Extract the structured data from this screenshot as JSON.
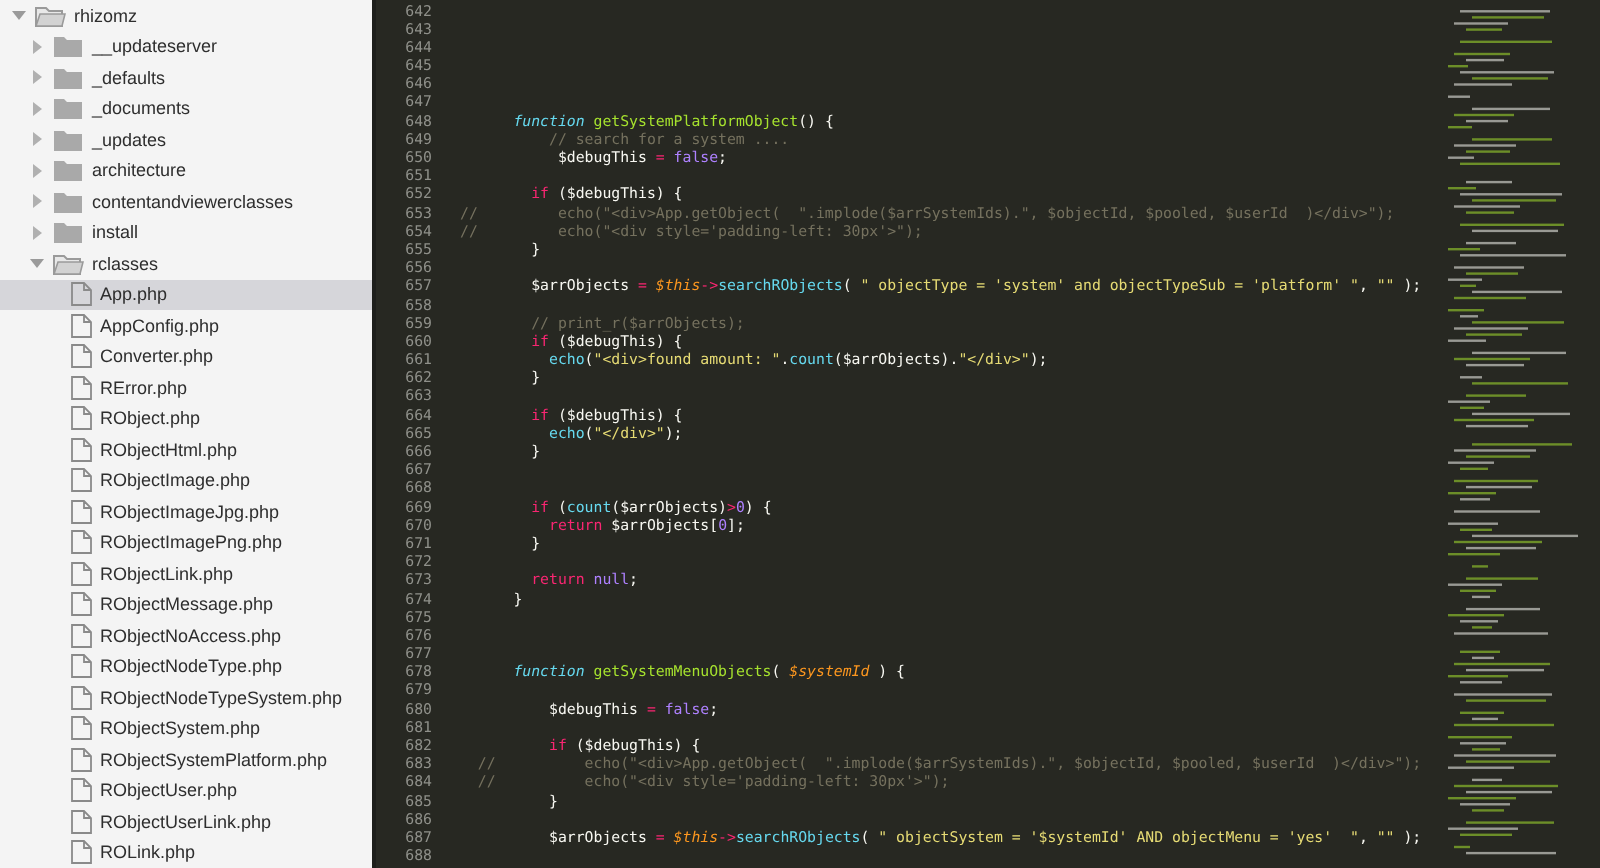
{
  "sidebar": {
    "items": [
      {
        "kind": "folder",
        "label": "rhizomz",
        "expanded": true,
        "selected": false,
        "children": [
          {
            "kind": "folder",
            "label": "__updateserver",
            "expanded": false,
            "selected": false
          },
          {
            "kind": "folder",
            "label": "_defaults",
            "expanded": false,
            "selected": false
          },
          {
            "kind": "folder",
            "label": "_documents",
            "expanded": false,
            "selected": false
          },
          {
            "kind": "folder",
            "label": "_updates",
            "expanded": false,
            "selected": false
          },
          {
            "kind": "folder",
            "label": "architecture",
            "expanded": false,
            "selected": false
          },
          {
            "kind": "folder",
            "label": "contentandviewerclasses",
            "expanded": false,
            "selected": false
          },
          {
            "kind": "folder",
            "label": "install",
            "expanded": false,
            "selected": false
          },
          {
            "kind": "folder",
            "label": "rclasses",
            "expanded": true,
            "selected": false,
            "children": [
              {
                "kind": "file",
                "label": "App.php",
                "selected": true
              },
              {
                "kind": "file",
                "label": "AppConfig.php",
                "selected": false
              },
              {
                "kind": "file",
                "label": "Converter.php",
                "selected": false
              },
              {
                "kind": "file",
                "label": "RError.php",
                "selected": false
              },
              {
                "kind": "file",
                "label": "RObject.php",
                "selected": false
              },
              {
                "kind": "file",
                "label": "RObjectHtml.php",
                "selected": false
              },
              {
                "kind": "file",
                "label": "RObjectImage.php",
                "selected": false
              },
              {
                "kind": "file",
                "label": "RObjectImageJpg.php",
                "selected": false
              },
              {
                "kind": "file",
                "label": "RObjectImagePng.php",
                "selected": false
              },
              {
                "kind": "file",
                "label": "RObjectLink.php",
                "selected": false
              },
              {
                "kind": "file",
                "label": "RObjectMessage.php",
                "selected": false
              },
              {
                "kind": "file",
                "label": "RObjectNoAccess.php",
                "selected": false
              },
              {
                "kind": "file",
                "label": "RObjectNodeType.php",
                "selected": false
              },
              {
                "kind": "file",
                "label": "RObjectNodeTypeSystem.php",
                "selected": false
              },
              {
                "kind": "file",
                "label": "RObjectSystem.php",
                "selected": false
              },
              {
                "kind": "file",
                "label": "RObjectSystemPlatform.php",
                "selected": false
              },
              {
                "kind": "file",
                "label": "RObjectUser.php",
                "selected": false
              },
              {
                "kind": "file",
                "label": "RObjectUserLink.php",
                "selected": false
              },
              {
                "kind": "file",
                "label": "ROLink.php",
                "selected": false
              }
            ]
          }
        ]
      }
    ]
  },
  "editor": {
    "lines": [
      {
        "number": "642"
      },
      {
        "number": "643"
      },
      {
        "number": "644"
      },
      {
        "number": "645"
      },
      {
        "number": "646"
      },
      {
        "number": "647"
      },
      {
        "number": "648",
        "tokens": [
          {
            "kind": "keyword",
            "text": "      function"
          },
          {
            "kind": "fn",
            "text": " getSystemPlatformObject"
          },
          {
            "kind": "plain",
            "text": "() {"
          }
        ]
      },
      {
        "number": "649",
        "tokens": [
          {
            "kind": "comment",
            "text": "          // search for a system ...."
          }
        ]
      },
      {
        "number": "650",
        "tokens": [
          {
            "kind": "plain",
            "text": "           $debugThis "
          },
          {
            "kind": "op",
            "text": "="
          },
          {
            "kind": "const",
            "text": " false"
          },
          {
            "kind": "plain",
            "text": ";"
          }
        ]
      },
      {
        "number": "651"
      },
      {
        "number": "652",
        "tokens": [
          {
            "kind": "ctrl",
            "text": "        if"
          },
          {
            "kind": "plain",
            "text": " ($debugThis) {"
          }
        ]
      },
      {
        "number": "653",
        "tokens": [
          {
            "kind": "comment",
            "text": "//         echo(\"<div>App.getObject(  \".implode($arrSystemIds).\", $objectId, $pooled, $userId  )</div>\");"
          }
        ]
      },
      {
        "number": "654",
        "tokens": [
          {
            "kind": "comment",
            "text": "//         echo(\"<div style='padding-left: 30px'>\");"
          }
        ]
      },
      {
        "number": "655",
        "tokens": [
          {
            "kind": "plain",
            "text": "        }"
          }
        ]
      },
      {
        "number": "656"
      },
      {
        "number": "657",
        "tokens": [
          {
            "kind": "plain",
            "text": "        $arrObjects "
          },
          {
            "kind": "op",
            "text": "="
          },
          {
            "kind": "this",
            "text": " $this"
          },
          {
            "kind": "op",
            "text": "->"
          },
          {
            "kind": "method",
            "text": "searchRObjects"
          },
          {
            "kind": "plain",
            "text": "( "
          },
          {
            "kind": "string",
            "text": "\" objectType = 'system' and objectTypeSub = 'platform' \""
          },
          {
            "kind": "plain",
            "text": ", "
          },
          {
            "kind": "string",
            "text": "\"\""
          },
          {
            "kind": "plain",
            "text": " );"
          }
        ]
      },
      {
        "number": "658"
      },
      {
        "number": "659",
        "tokens": [
          {
            "kind": "comment",
            "text": "        // print_r($arrObjects);"
          }
        ]
      },
      {
        "number": "660",
        "tokens": [
          {
            "kind": "ctrl",
            "text": "        if"
          },
          {
            "kind": "plain",
            "text": " ($debugThis) {"
          }
        ]
      },
      {
        "number": "661",
        "tokens": [
          {
            "kind": "method",
            "text": "          echo"
          },
          {
            "kind": "plain",
            "text": "("
          },
          {
            "kind": "string",
            "text": "\"<div>found amount: \""
          },
          {
            "kind": "plain",
            "text": "."
          },
          {
            "kind": "method",
            "text": "count"
          },
          {
            "kind": "plain",
            "text": "($arrObjects)."
          },
          {
            "kind": "string",
            "text": "\"</div>\""
          },
          {
            "kind": "plain",
            "text": ");"
          }
        ]
      },
      {
        "number": "662",
        "tokens": [
          {
            "kind": "plain",
            "text": "        }"
          }
        ]
      },
      {
        "number": "663"
      },
      {
        "number": "664",
        "tokens": [
          {
            "kind": "ctrl",
            "text": "        if"
          },
          {
            "kind": "plain",
            "text": " ($debugThis) {"
          }
        ]
      },
      {
        "number": "665",
        "tokens": [
          {
            "kind": "method",
            "text": "          echo"
          },
          {
            "kind": "plain",
            "text": "("
          },
          {
            "kind": "string",
            "text": "\"</div>\""
          },
          {
            "kind": "plain",
            "text": ");"
          }
        ]
      },
      {
        "number": "666",
        "tokens": [
          {
            "kind": "plain",
            "text": "        }"
          }
        ]
      },
      {
        "number": "667"
      },
      {
        "number": "668"
      },
      {
        "number": "669",
        "tokens": [
          {
            "kind": "ctrl",
            "text": "        if"
          },
          {
            "kind": "plain",
            "text": " ("
          },
          {
            "kind": "method",
            "text": "count"
          },
          {
            "kind": "plain",
            "text": "($arrObjects)"
          },
          {
            "kind": "op",
            "text": ">"
          },
          {
            "kind": "const",
            "text": "0"
          },
          {
            "kind": "plain",
            "text": ") {"
          }
        ]
      },
      {
        "number": "670",
        "tokens": [
          {
            "kind": "ctrl",
            "text": "          return"
          },
          {
            "kind": "plain",
            "text": " $arrObjects["
          },
          {
            "kind": "const",
            "text": "0"
          },
          {
            "kind": "plain",
            "text": "];"
          }
        ]
      },
      {
        "number": "671",
        "tokens": [
          {
            "kind": "plain",
            "text": "        }"
          }
        ]
      },
      {
        "number": "672"
      },
      {
        "number": "673",
        "tokens": [
          {
            "kind": "ctrl",
            "text": "        return"
          },
          {
            "kind": "const",
            "text": " null"
          },
          {
            "kind": "plain",
            "text": ";"
          }
        ]
      },
      {
        "number": "674",
        "tokens": [
          {
            "kind": "plain",
            "text": "      }"
          }
        ]
      },
      {
        "number": "675"
      },
      {
        "number": "676"
      },
      {
        "number": "677"
      },
      {
        "number": "678",
        "tokens": [
          {
            "kind": "keyword",
            "text": "      function"
          },
          {
            "kind": "fn",
            "text": " getSystemMenuObjects"
          },
          {
            "kind": "plain",
            "text": "( "
          },
          {
            "kind": "param",
            "text": "$systemId"
          },
          {
            "kind": "plain",
            "text": " ) {"
          }
        ]
      },
      {
        "number": "679"
      },
      {
        "number": "680",
        "tokens": [
          {
            "kind": "plain",
            "text": "          $debugThis "
          },
          {
            "kind": "op",
            "text": "="
          },
          {
            "kind": "const",
            "text": " false"
          },
          {
            "kind": "plain",
            "text": ";"
          }
        ]
      },
      {
        "number": "681"
      },
      {
        "number": "682",
        "tokens": [
          {
            "kind": "ctrl",
            "text": "          if"
          },
          {
            "kind": "plain",
            "text": " ($debugThis) {"
          }
        ]
      },
      {
        "number": "683",
        "tokens": [
          {
            "kind": "comment",
            "text": "  //          echo(\"<div>App.getObject(  \".implode($arrSystemIds).\", $objectId, $pooled, $userId  )</div>\");"
          }
        ]
      },
      {
        "number": "684",
        "tokens": [
          {
            "kind": "comment",
            "text": "  //          echo(\"<div style='padding-left: 30px'>\");"
          }
        ]
      },
      {
        "number": "685",
        "tokens": [
          {
            "kind": "plain",
            "text": "          }"
          }
        ]
      },
      {
        "number": "686"
      },
      {
        "number": "687",
        "tokens": [
          {
            "kind": "plain",
            "text": "          $arrObjects "
          },
          {
            "kind": "op",
            "text": "="
          },
          {
            "kind": "this",
            "text": " $this"
          },
          {
            "kind": "op",
            "text": "->"
          },
          {
            "kind": "method",
            "text": "searchRObjects"
          },
          {
            "kind": "plain",
            "text": "( "
          },
          {
            "kind": "string",
            "text": "\" objectSystem = '$systemId' AND objectMenu = 'yes'  \""
          },
          {
            "kind": "plain",
            "text": ", "
          },
          {
            "kind": "string",
            "text": "\"\""
          },
          {
            "kind": "plain",
            "text": " );"
          }
        ]
      },
      {
        "number": "688"
      }
    ]
  }
}
